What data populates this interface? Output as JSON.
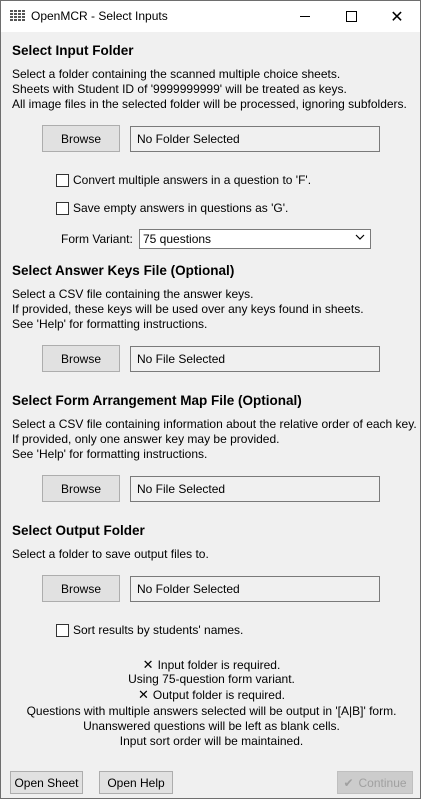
{
  "window": {
    "title": "OpenMCR - Select Inputs"
  },
  "input_folder": {
    "heading": "Select Input Folder",
    "desc": [
      "Select a folder containing the scanned multiple choice sheets.",
      "Sheets with Student ID of '9999999999' will be treated as keys.",
      "All image files in the selected folder will be processed, ignoring subfolders."
    ],
    "browse_label": "Browse",
    "path_value": "No Folder Selected",
    "convert_label": "Convert multiple answers in a question to 'F'.",
    "save_empty_label": "Save empty answers in questions as 'G'.",
    "form_variant_label": "Form Variant:",
    "form_variant_value": "75 questions"
  },
  "answer_keys": {
    "heading": "Select Answer Keys File (Optional)",
    "desc": [
      "Select a CSV file containing the answer keys.",
      "If provided, these keys will be used over any keys found in sheets.",
      "See 'Help' for formatting instructions."
    ],
    "browse_label": "Browse",
    "path_value": "No File Selected"
  },
  "arrangement_map": {
    "heading": "Select Form Arrangement Map File (Optional)",
    "desc": [
      "Select a CSV file containing information about the relative order of each key.",
      "If provided, only one answer key may be provided.",
      "See 'Help' for formatting instructions."
    ],
    "browse_label": "Browse",
    "path_value": "No File Selected"
  },
  "output_folder": {
    "heading": "Select Output Folder",
    "desc": "Select a folder to save output files to.",
    "browse_label": "Browse",
    "path_value": "No Folder Selected",
    "sort_label": "Sort results by students' names."
  },
  "status": {
    "input_required": "Input folder is required.",
    "variant": "Using 75-question form variant.",
    "output_required": "Output folder is required.",
    "multiple_answers": "Questions with multiple answers selected will be output in '[A|B]' form.",
    "unanswered": "Unanswered questions will be left as blank cells.",
    "sort_order": "Input sort order will be maintained."
  },
  "footer": {
    "open_sheet": "Open Sheet",
    "open_help": "Open Help",
    "continue": "Continue"
  },
  "icons": {
    "x_mark": "✕",
    "check": "✔",
    "chevron": "⌄"
  }
}
